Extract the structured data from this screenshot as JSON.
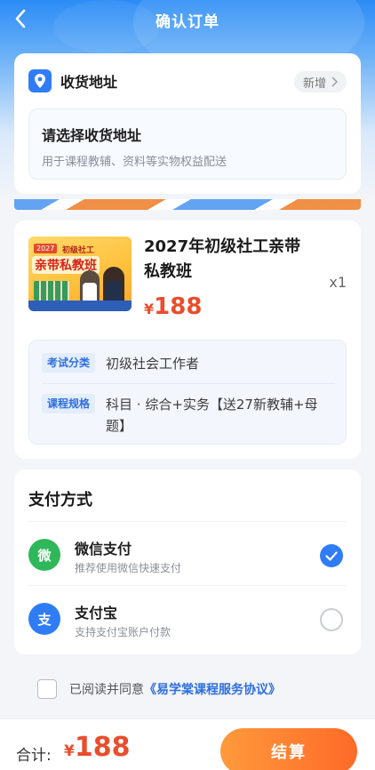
{
  "header": {
    "title": "确认订单",
    "back_icon": "chevron-left-icon"
  },
  "address": {
    "title": "收货地址",
    "icon": "location-pin-icon",
    "add_label": "新增",
    "placeholder_title": "请选择收货地址",
    "placeholder_desc": "用于课程教辅、资料等实物权益配送"
  },
  "product": {
    "name": "2027年初级社工亲带私教班",
    "quantity": "x1",
    "price_symbol": "¥",
    "price": "188",
    "thumbnail": {
      "badge": "2027",
      "subtitle": "初级社工",
      "title": "亲带私教班"
    },
    "specs": [
      {
        "label": "考试分类",
        "value": "初级社会工作者"
      },
      {
        "label": "课程规格",
        "value": "科目 · 综合+实务【送27新教辅+母题】"
      }
    ]
  },
  "payment": {
    "title": "支付方式",
    "methods": [
      {
        "icon_char": "微",
        "name": "微信支付",
        "desc": "推荐使用微信快速支付",
        "color": "#2fb85a",
        "selected": true
      },
      {
        "icon_char": "支",
        "name": "支付宝",
        "desc": "支持支付宝账户付款",
        "color": "#2f7df6",
        "selected": false
      }
    ]
  },
  "agreement": {
    "text": "已阅读并同意",
    "link": "《易学棠课程服务协议》",
    "checked": false
  },
  "footer": {
    "total_label": "合计:",
    "total_symbol": "¥",
    "total_value": "188",
    "checkout_label": "结算"
  },
  "colors": {
    "primary_blue": "#2f7df6",
    "price_red": "#e94d2c",
    "button_orange": "#ff7a2f"
  }
}
